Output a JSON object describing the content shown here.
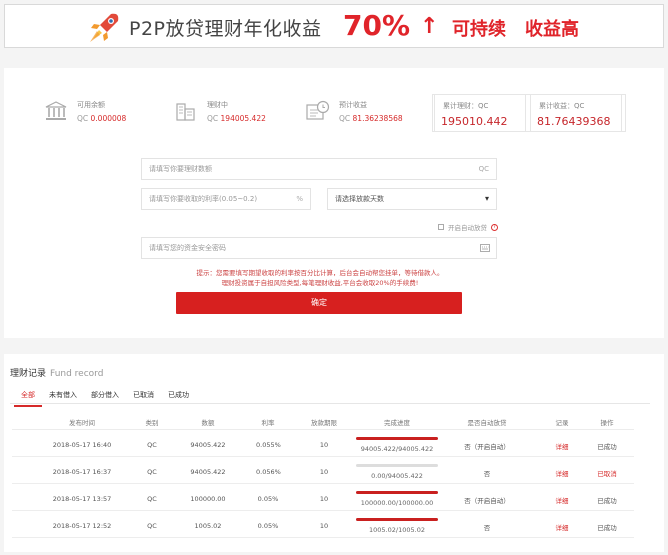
{
  "banner": {
    "title": "P2P放贷理财年化收益",
    "percent": "70%",
    "arrow": "↑",
    "sustainable": "可持续",
    "high_return": "收益高"
  },
  "stats": [
    {
      "icon": "bank-icon",
      "label": "可用余额",
      "currency": "QC",
      "value": "0.000008"
    },
    {
      "icon": "building-icon",
      "label": "理财中",
      "currency": "QC",
      "value": "194005.422"
    },
    {
      "icon": "clock-screen-icon",
      "label": "预计收益",
      "currency": "QC",
      "value": "81.36238568"
    }
  ],
  "summary": [
    {
      "label": "累计理财：QC",
      "value": "195010.442"
    },
    {
      "label": "累计收益：QC",
      "value": "81.76439368"
    }
  ],
  "form": {
    "amount_placeholder": "请填写你要理财数额",
    "amount_suffix": "QC",
    "rate_placeholder": "请填写你要收取的利率(0.05~0.2)",
    "rate_suffix": "%",
    "days_select": "请选择放款天数",
    "days_caret": "▾",
    "auto_lend_label": "开启自动放贷",
    "password_placeholder": "请填写您的资金安全密码",
    "tip_line1": "提示：您需要填写期望收取的利率按百分比计算，后台会自动帮您挂单，等待借款人。",
    "tip_line2": "理财投资属于自担风险类型,每笔理财收益,平台会收取20%的手续费!",
    "confirm_label": "确定"
  },
  "records": {
    "title": "理财记录",
    "title_en": "Fund record",
    "tabs": [
      "全部",
      "未有借入",
      "部分借入",
      "已取消",
      "已成功"
    ],
    "active_tab": 0,
    "columns": [
      "发布时间",
      "类别",
      "数额",
      "利率",
      "放款期限",
      "完成进度",
      "是否自动放贷",
      "记录",
      "操作"
    ],
    "rows": [
      {
        "time": "2018-05-17 16:40",
        "type": "QC",
        "amount": "94005.422",
        "rate": "0.055%",
        "term": "10",
        "progress": 1.0,
        "progress_text": "94005.422/94005.422",
        "auto": "否（开启自动）",
        "record": "详细",
        "action": "已成功",
        "action_red": false
      },
      {
        "time": "2018-05-17 16:37",
        "type": "QC",
        "amount": "94005.422",
        "rate": "0.056%",
        "term": "10",
        "progress": 0.0,
        "progress_text": "0.00/94005.422",
        "auto": "否",
        "record": "详细",
        "action": "已取消",
        "action_red": true
      },
      {
        "time": "2018-05-17 13:57",
        "type": "QC",
        "amount": "100000.00",
        "rate": "0.05%",
        "term": "10",
        "progress": 1.0,
        "progress_text": "100000.00/100000.00",
        "auto": "否（开启自动）",
        "record": "详细",
        "action": "已成功",
        "action_red": false
      },
      {
        "time": "2018-05-17 12:52",
        "type": "QC",
        "amount": "1005.02",
        "rate": "0.05%",
        "term": "10",
        "progress": 1.0,
        "progress_text": "1005.02/1005.02",
        "auto": "否",
        "record": "详细",
        "action": "已成功",
        "action_red": false
      }
    ]
  },
  "colors": {
    "accent": "#d7201f",
    "text_red": "#c6262b"
  }
}
